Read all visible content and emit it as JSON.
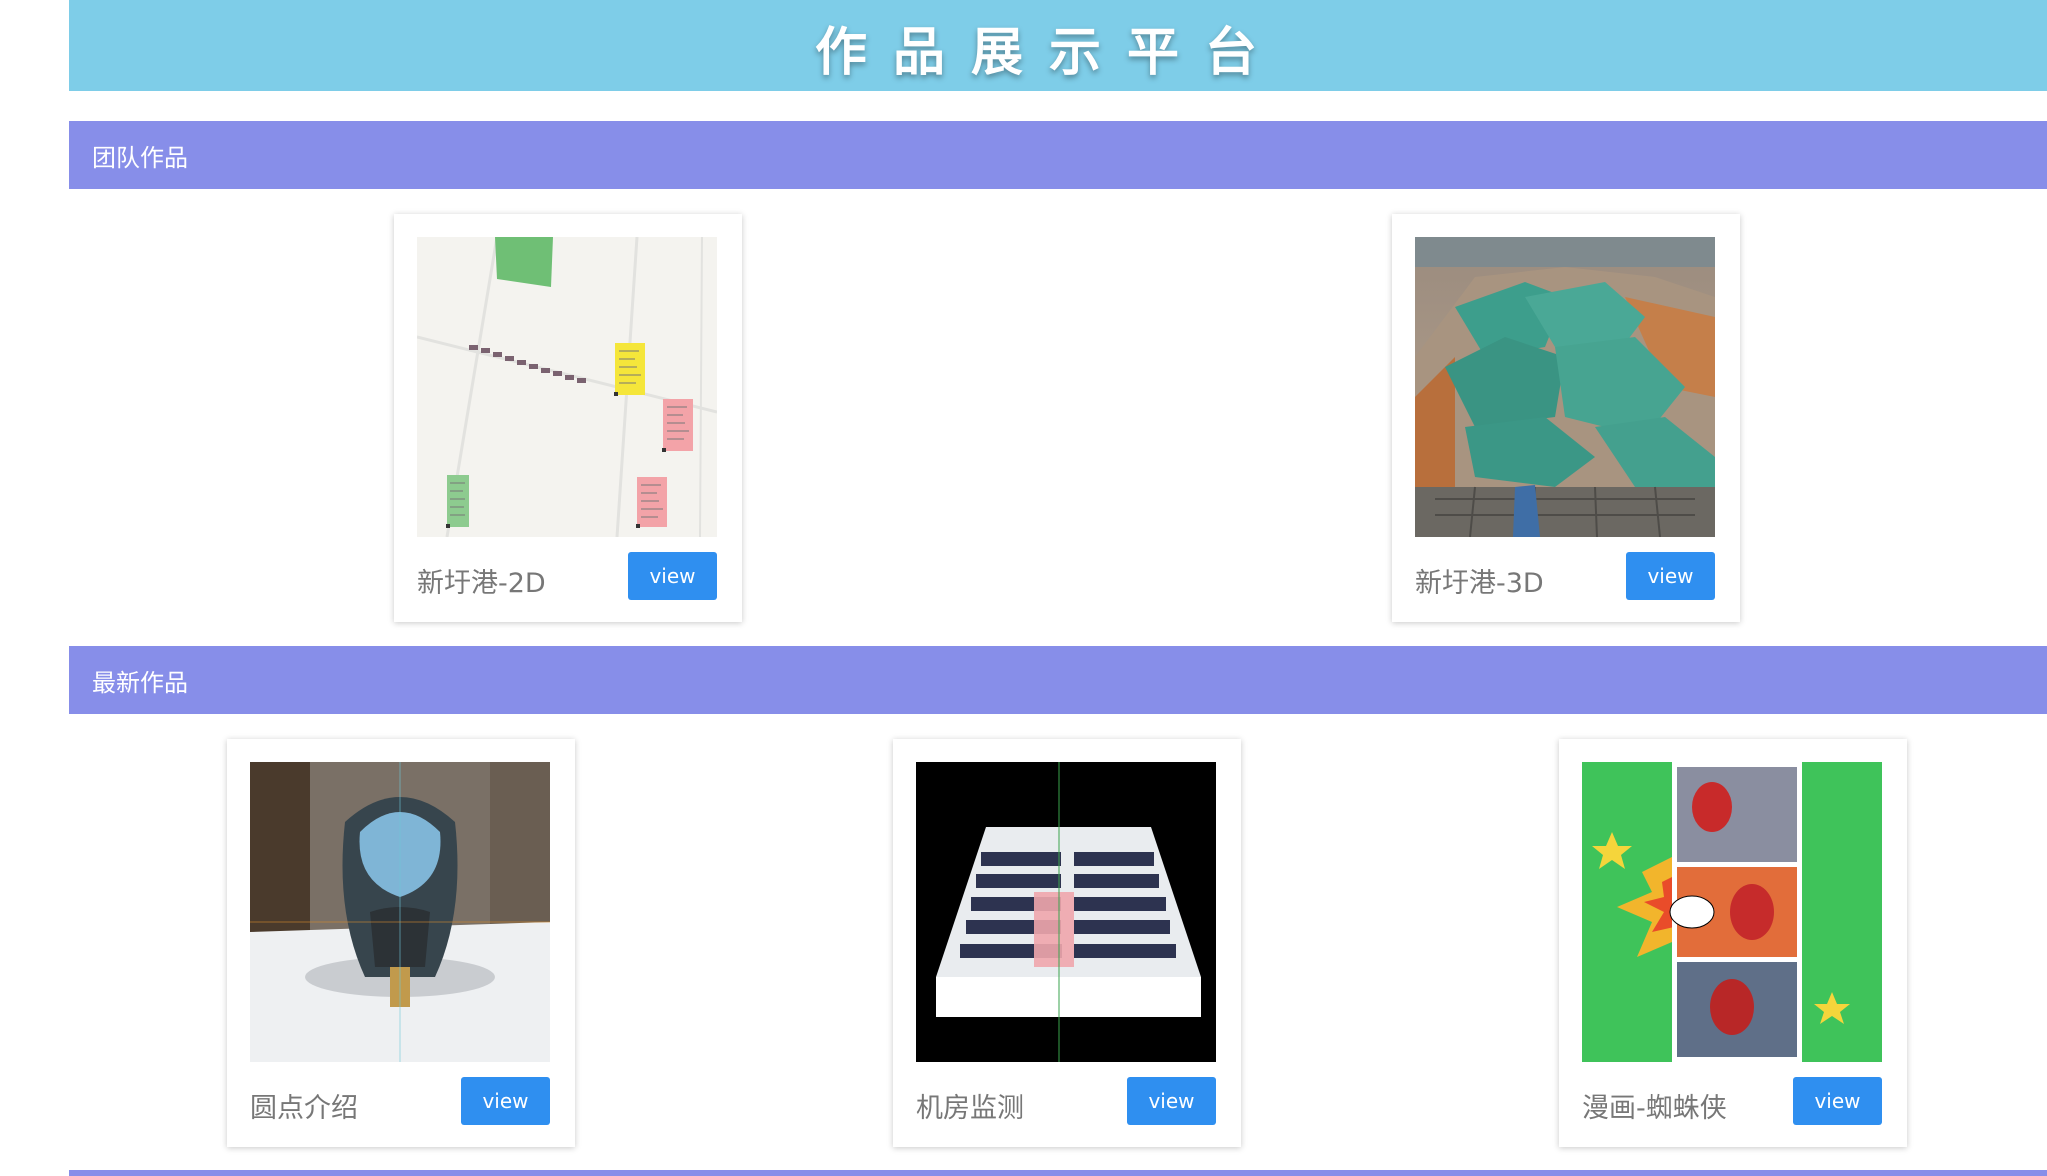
{
  "header": {
    "title": "作品展示平台"
  },
  "sections": {
    "team": {
      "label": "团队作品",
      "items": [
        {
          "title": "新圩港-2D",
          "button": "view",
          "thumbnail": "2d-map-with-labels"
        },
        {
          "title": "新圩港-3D",
          "button": "view",
          "thumbnail": "3d-terrain-with-covered-piles"
        }
      ]
    },
    "latest": {
      "label": "最新作品",
      "items": [
        {
          "title": "圆点介绍",
          "button": "view",
          "thumbnail": "3d-helmet-model"
        },
        {
          "title": "机房监测",
          "button": "view",
          "thumbnail": "server-room-3d"
        },
        {
          "title": "漫画-蜘蛛侠",
          "button": "view",
          "thumbnail": "comic-page"
        }
      ]
    }
  },
  "colors": {
    "header_bg": "#7ecde8",
    "section_bar": "#878ee9",
    "button": "#2f8ff0",
    "title_text": "#777777"
  }
}
